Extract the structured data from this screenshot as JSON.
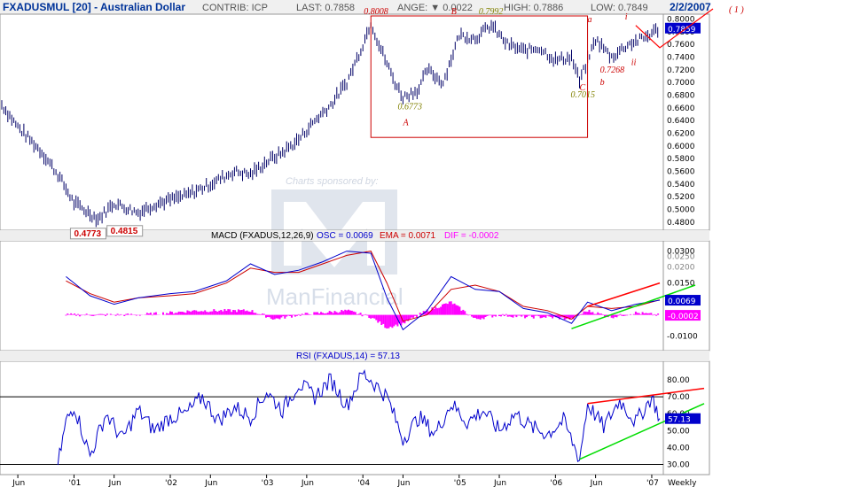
{
  "header": {
    "symbol": "FXADUSMUL [20] - Australian Dollar",
    "contrib": "CONTRIB: ICP",
    "last": "LAST: 0.7858",
    "change": "ANGE: ▼ 0.0022",
    "high": "HIGH: 0.7886",
    "low": "LOW: 0.7849",
    "date": "2/2/2007",
    "wave_label": "( 1 )"
  },
  "watermark": {
    "sponsor_text": "Charts sponsored by:",
    "brand_text": "ManFinancial"
  },
  "colors": {
    "price": "#000066",
    "macd_line": "#0000cc",
    "macd_signal": "#cc0000",
    "macd_hist": "#ff00ff",
    "rsi_line": "#0000cc",
    "trend_red": "#ff0000",
    "trend_green": "#00dd00",
    "annot_red": "#cc0000",
    "annot_olive": "#808000",
    "value_box": "#0000cc"
  },
  "chart_data": [
    {
      "type": "line",
      "name": "price",
      "ylim": [
        0.47,
        0.805
      ],
      "yticks": [
        0.48,
        0.5,
        0.52,
        0.54,
        0.56,
        0.58,
        0.6,
        0.62,
        0.64,
        0.66,
        0.68,
        0.7,
        0.72,
        0.74,
        0.76,
        0.78,
        0.8
      ],
      "ytick_labels": [
        "0.4800",
        "0.5000",
        "0.5200",
        "0.5400",
        "0.5600",
        "0.5800",
        "0.6000",
        "0.6200",
        "0.6400",
        "0.6600",
        "0.6800",
        "0.7000",
        "0.7200",
        "0.7400",
        "0.7600",
        "0.7800",
        "0.8000"
      ],
      "x": [
        "2000-04",
        "2000-06",
        "2000-09",
        "2000-11",
        "2001-01",
        "2001-04",
        "2001-06",
        "2001-09",
        "2001-11",
        "2002-01",
        "2002-03",
        "2002-06",
        "2002-09",
        "2002-11",
        "2003-01",
        "2003-03",
        "2003-05",
        "2003-07",
        "2003-09",
        "2003-11",
        "2004-01",
        "2004-02",
        "2004-03",
        "2004-05",
        "2004-06",
        "2004-08",
        "2004-09",
        "2004-11",
        "2005-01",
        "2005-03",
        "2005-05",
        "2005-07",
        "2005-09",
        "2005-11",
        "2006-01",
        "2006-03",
        "2006-04",
        "2006-06",
        "2006-08",
        "2006-10",
        "2006-12",
        "2007-02"
      ],
      "values": [
        0.665,
        0.63,
        0.59,
        0.555,
        0.51,
        0.485,
        0.51,
        0.495,
        0.508,
        0.515,
        0.522,
        0.54,
        0.56,
        0.555,
        0.575,
        0.59,
        0.61,
        0.64,
        0.665,
        0.7,
        0.76,
        0.795,
        0.76,
        0.7,
        0.677,
        0.69,
        0.72,
        0.7,
        0.775,
        0.77,
        0.79,
        0.76,
        0.75,
        0.755,
        0.735,
        0.74,
        0.7015,
        0.768,
        0.74,
        0.76,
        0.77,
        0.7858
      ],
      "current_value": "0.7859",
      "annotations": [
        {
          "text": "0.4773",
          "x": "2001-01",
          "y": 0.4773
        },
        {
          "text": "0.4815",
          "x": "2001-06",
          "y": 0.4815
        },
        {
          "text": "0.8008",
          "x": "2004-02",
          "y": 0.8008
        },
        {
          "text": "0.7992",
          "x": "2005-03",
          "y": 0.7992
        },
        {
          "text": "0.6773",
          "x": "2004-06",
          "y": 0.6773
        },
        {
          "text": "0.7015",
          "x": "2006-04",
          "y": 0.7015
        },
        {
          "text": "0.7268",
          "x": "2006-07",
          "y": 0.7268
        },
        {
          "text": "A",
          "x": "2004-06"
        },
        {
          "text": "B",
          "x": "2004-12"
        },
        {
          "text": "C",
          "x": "2006-04"
        },
        {
          "text": "a",
          "x": "2006-05"
        },
        {
          "text": "b",
          "x": "2006-07"
        },
        {
          "text": "i",
          "x": "2006-09"
        },
        {
          "text": "ii",
          "x": "2006-10"
        },
        {
          "text": "iii",
          "x": "2007-01"
        }
      ]
    },
    {
      "type": "line",
      "name": "macd",
      "title": "MACD (FXADUS,12,26,9)",
      "osc_label": "OSC = 0.0069",
      "ema_label": "EMA = 0.0071",
      "dif_label": "DIF = -0.0002",
      "ylim": [
        -0.016,
        0.034
      ],
      "yticks": [
        -0.01,
        0.0,
        0.015,
        0.03
      ],
      "ytick_labels": [
        "-0.0100",
        "0.0000",
        "0.0150",
        "0.0300"
      ],
      "partial_ticks": [
        "0.0200",
        "0.0250"
      ],
      "current_osc": "0.0069",
      "current_dif": "-0.0002",
      "x": [
        "2000-12",
        "2001-03",
        "2001-06",
        "2001-09",
        "2002-01",
        "2002-04",
        "2002-08",
        "2002-11",
        "2003-02",
        "2003-05",
        "2003-08",
        "2003-11",
        "2004-02",
        "2004-04",
        "2004-06",
        "2004-09",
        "2004-12",
        "2005-03",
        "2005-06",
        "2005-09",
        "2005-12",
        "2006-03",
        "2006-05",
        "2006-08",
        "2006-11",
        "2007-02"
      ],
      "osc": [
        0.018,
        0.009,
        0.005,
        0.008,
        0.01,
        0.011,
        0.016,
        0.024,
        0.019,
        0.021,
        0.025,
        0.03,
        0.029,
        0.008,
        -0.007,
        0.002,
        0.018,
        0.012,
        0.011,
        0.003,
        0.001,
        -0.004,
        0.006,
        0.002,
        0.005,
        0.0069
      ],
      "ema": [
        0.016,
        0.01,
        0.006,
        0.008,
        0.009,
        0.01,
        0.015,
        0.022,
        0.02,
        0.02,
        0.024,
        0.028,
        0.03,
        0.015,
        -0.003,
        0.0,
        0.012,
        0.014,
        0.011,
        0.004,
        0.002,
        -0.002,
        0.004,
        0.003,
        0.004,
        0.0071
      ],
      "dif": [
        0.0,
        0.0,
        0.0,
        0.0,
        0.001,
        0.002,
        0.002,
        0.002,
        -0.002,
        0.0,
        0.001,
        0.002,
        -0.001,
        -0.006,
        -0.004,
        0.002,
        0.006,
        -0.002,
        0.0,
        -0.001,
        -0.001,
        -0.002,
        0.002,
        -0.001,
        0.001,
        -0.0002
      ]
    },
    {
      "type": "line",
      "name": "rsi",
      "title": "RSI (FXADUS,14) = 57.13",
      "ylim": [
        25,
        90
      ],
      "yticks": [
        30,
        40,
        50,
        60,
        70,
        80
      ],
      "ytick_labels": [
        "30.00",
        "40.00",
        "50.00",
        "60.00",
        "70.00",
        "80.00"
      ],
      "hlines": [
        30,
        70
      ],
      "current_value": "57.13",
      "x": [
        "2000-11",
        "2000-12",
        "2001-01",
        "2001-03",
        "2001-05",
        "2001-07",
        "2001-09",
        "2001-11",
        "2002-01",
        "2002-03",
        "2002-05",
        "2002-07",
        "2002-09",
        "2002-11",
        "2003-01",
        "2003-03",
        "2003-05",
        "2003-07",
        "2003-09",
        "2003-11",
        "2004-01",
        "2004-02",
        "2004-04",
        "2004-06",
        "2004-08",
        "2004-10",
        "2004-12",
        "2005-02",
        "2005-04",
        "2005-06",
        "2005-08",
        "2005-10",
        "2005-12",
        "2006-02",
        "2006-04",
        "2006-05",
        "2006-07",
        "2006-09",
        "2006-11",
        "2007-01",
        "2007-02"
      ],
      "values": [
        30,
        55,
        65,
        35,
        60,
        45,
        62,
        50,
        58,
        60,
        70,
        56,
        64,
        58,
        73,
        62,
        78,
        70,
        80,
        65,
        84,
        80,
        70,
        45,
        58,
        48,
        66,
        55,
        62,
        50,
        60,
        52,
        48,
        56,
        33,
        66,
        52,
        68,
        55,
        70,
        57.13
      ]
    }
  ],
  "time_axis": {
    "labels": [
      "Jun",
      "'01",
      "Jun",
      "'02",
      "Jun",
      "'03",
      "Jun",
      "'04",
      "Jun",
      "'05",
      "Jun",
      "'06",
      "Jun",
      "'07"
    ],
    "label_dates": [
      "2000-06",
      "2001-01",
      "2001-06",
      "2002-01",
      "2002-06",
      "2003-01",
      "2003-06",
      "2004-01",
      "2004-06",
      "2005-01",
      "2005-06",
      "2006-01",
      "2006-06",
      "2007-01"
    ],
    "period": "Weekly"
  }
}
